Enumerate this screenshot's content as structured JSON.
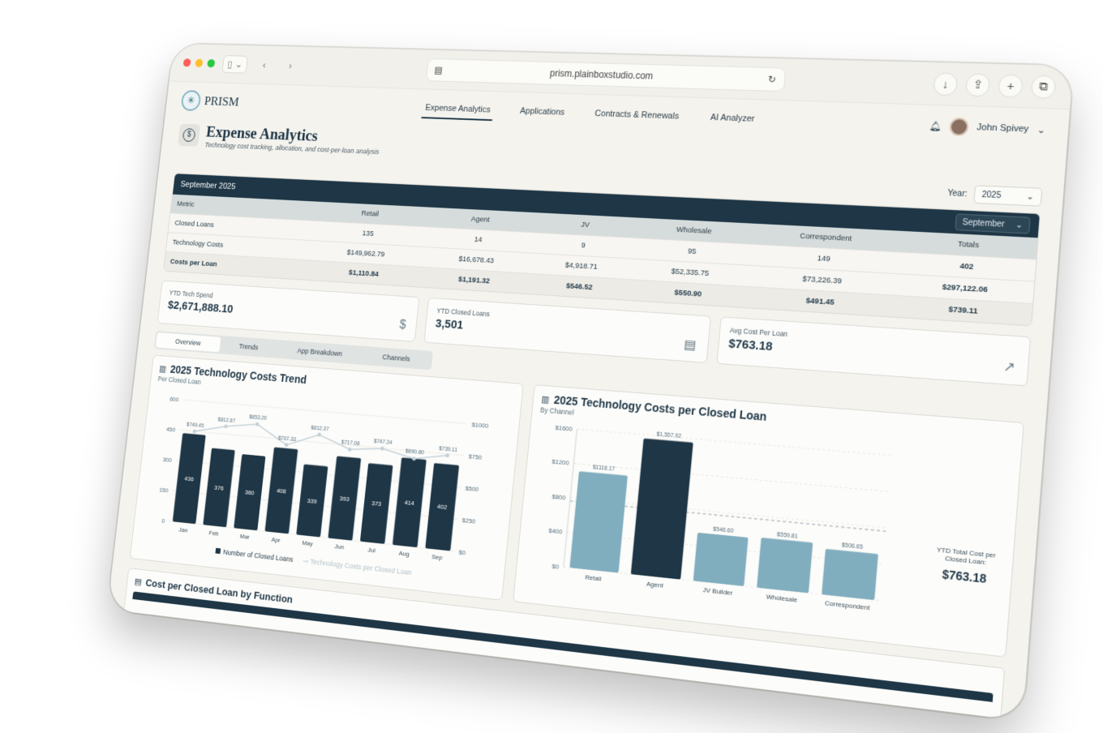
{
  "browser": {
    "url": "prism.plainboxstudio.com"
  },
  "app": {
    "logo_text": "PRISM",
    "nav_tabs": [
      "Expense Analytics",
      "Applications",
      "Contracts & Renewals",
      "AI Analyzer"
    ],
    "active_tab": "Expense Analytics",
    "user_name": "John Spivey"
  },
  "page": {
    "title": "Expense Analytics",
    "subtitle": "Technology cost tracking, allocation, and cost-per-loan analysis",
    "year_label": "Year:",
    "year_value": "2025"
  },
  "summary_table": {
    "heading": "September 2025",
    "month_select": "September",
    "columns": [
      "Metric",
      "Retail",
      "Agent",
      "JV",
      "Wholesale",
      "Correspondent",
      "Totals"
    ],
    "rows": [
      [
        "Closed Loans",
        "135",
        "14",
        "9",
        "95",
        "149",
        "402"
      ],
      [
        "Technology Costs",
        "$149,962.79",
        "$16,678.43",
        "$4,918.71",
        "$52,335.75",
        "$73,226.39",
        "$297,122.06"
      ],
      [
        "Costs per Loan",
        "$1,110.84",
        "$1,191.32",
        "$546.52",
        "$550.90",
        "$491.45",
        "$739.11"
      ]
    ]
  },
  "stats": [
    {
      "label": "YTD Tech Spend",
      "value": "$2,671,888.10",
      "icon": "dollar-icon"
    },
    {
      "label": "YTD Closed Loans",
      "value": "3,501",
      "icon": "document-icon"
    },
    {
      "label": "Avg Cost Per Loan",
      "value": "$763.18",
      "icon": "trending-up-icon"
    }
  ],
  "view_tabs": [
    "Overview",
    "Trends",
    "App Breakdown",
    "Channels"
  ],
  "active_view": "Overview",
  "charts": {
    "trend": {
      "title": "2025 Technology Costs Trend",
      "subtitle": "Per Closed Loan",
      "legend_bars": "Number of Closed Loans",
      "legend_line": "Technology Costs per Closed Loan"
    },
    "channel": {
      "title": "2025 Technology Costs per Closed Loan",
      "subtitle": "By Channel",
      "ytd_label": "YTD Total Cost per Closed Loan:",
      "ytd_value": "$763.18"
    }
  },
  "bottom_section": {
    "title": "Cost per Closed Loan by Function"
  },
  "chart_data": [
    {
      "type": "bar",
      "title": "2025 Technology Costs Trend",
      "subtitle": "Per Closed Loan",
      "categories": [
        "Jan",
        "Feb",
        "Mar",
        "Apr",
        "May",
        "Jun",
        "Jul",
        "Aug",
        "Sep"
      ],
      "series": [
        {
          "name": "Number of Closed Loans",
          "type": "bar",
          "values": [
            436,
            376,
            360,
            408,
            339,
            393,
            373,
            414,
            402
          ]
        },
        {
          "name": "Technology Costs per Closed Loan",
          "type": "line",
          "values": [
            749.45,
            812.67,
            853.2,
            707.33,
            812.37,
            717.08,
            747.24,
            690.8,
            739.11
          ],
          "labels": [
            "$749.45",
            "$812.67",
            "$853.20",
            "$707.33",
            "$812.37",
            "$717.08",
            "$747.24",
            "$690.80",
            "$739.11"
          ]
        }
      ],
      "y_left": {
        "ticks": [
          "600",
          "450",
          "300",
          "150",
          "0"
        ],
        "range": [
          0,
          600
        ]
      },
      "y_right": {
        "ticks": [
          "$1000",
          "$750",
          "$500",
          "$250",
          "$0"
        ],
        "range": [
          0,
          1000
        ]
      }
    },
    {
      "type": "bar",
      "title": "2025 Technology Costs per Closed Loan",
      "subtitle": "By Channel",
      "categories": [
        "Retail",
        "Agent",
        "JV Builder",
        "Wholesale",
        "Correspondent"
      ],
      "values": [
        1116.17,
        1557.92,
        546.6,
        559.81,
        506.65
      ],
      "labels": [
        "$1116.17",
        "$1,557.92",
        "$546.60",
        "$559.81",
        "$506.65"
      ],
      "ylim": [
        0,
        1600
      ],
      "y_ticks": [
        "$1600",
        "$1200",
        "$800",
        "$400",
        "$0"
      ],
      "reference_line": 763.18,
      "highlight_index": 1,
      "colors": {
        "default": "#81aebf",
        "highlight": "#1e3646"
      }
    }
  ]
}
